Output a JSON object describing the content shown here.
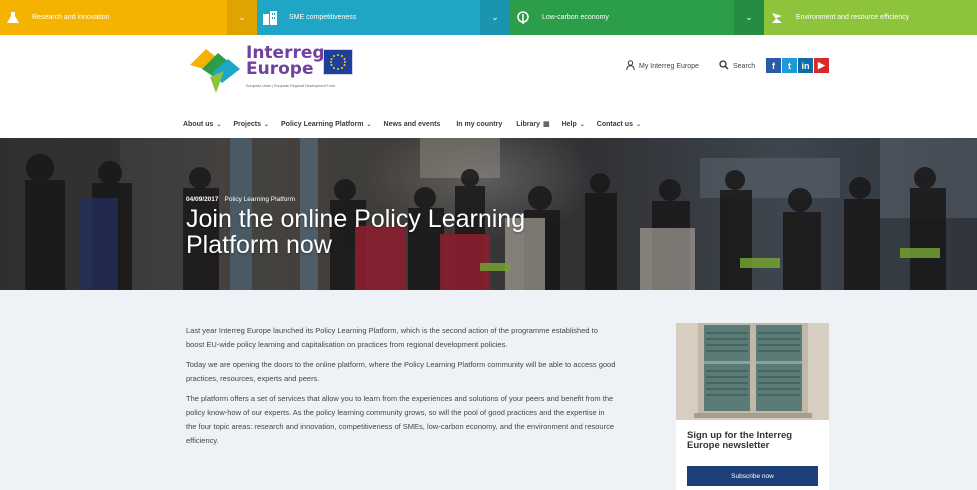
{
  "topics": [
    {
      "label": "Research and innovation",
      "icon": "flask-icon",
      "color": "#f4b300"
    },
    {
      "label": "SME competitiveness",
      "icon": "buildings-icon",
      "color": "#1fa5c5"
    },
    {
      "label": "Low-carbon economy",
      "icon": "leaf-icon",
      "color": "#2c9d49"
    },
    {
      "label": "Environment and resource efficiency",
      "icon": "recycle-icon",
      "color": "#8dc43c"
    }
  ],
  "logo": {
    "line1": "Interreg",
    "line2": "Europe",
    "subtitle": "European Union | European Regional Development Fund"
  },
  "utility": {
    "my_interreg": "My Interreg Europe",
    "search": "Search"
  },
  "social": {
    "facebook": "f",
    "twitter": "t",
    "linkedin": "in",
    "youtube": "▶"
  },
  "nav": {
    "about": "About us",
    "projects": "Projects",
    "plp": "Policy Learning Platform",
    "news": "News and events",
    "country": "In my country",
    "library": "Library",
    "help": "Help",
    "contact": "Contact us"
  },
  "hero": {
    "date": "04/09/2017",
    "category": "Policy Learning Platform",
    "title": "Join the online Policy Learning Platform now"
  },
  "article": {
    "p1": "Last year Interreg Europe launched its Policy Learning Platform, which is the second action of the programme established to boost EU-wide policy learning and capitalisation on practices from regional development policies.",
    "p2": "Today we are opening the doors to the online platform, where the Policy Learning Platform community will be able to access good practices, resources, experts and peers.",
    "p3": "The platform offers a set of services that allow you to learn from the experiences and solutions of your peers and benefit from the policy know-how of our experts. As the policy learning community grows, so will the pool of good practices and the expertise in the four topic areas: research and innovation, competitiveness of SMEs, low-carbon economy, and the environment and resource efficiency."
  },
  "sidebar": {
    "newsletter_title": "Sign up for the Interreg Europe newsletter",
    "subscribe_label": "Subscribe now"
  }
}
